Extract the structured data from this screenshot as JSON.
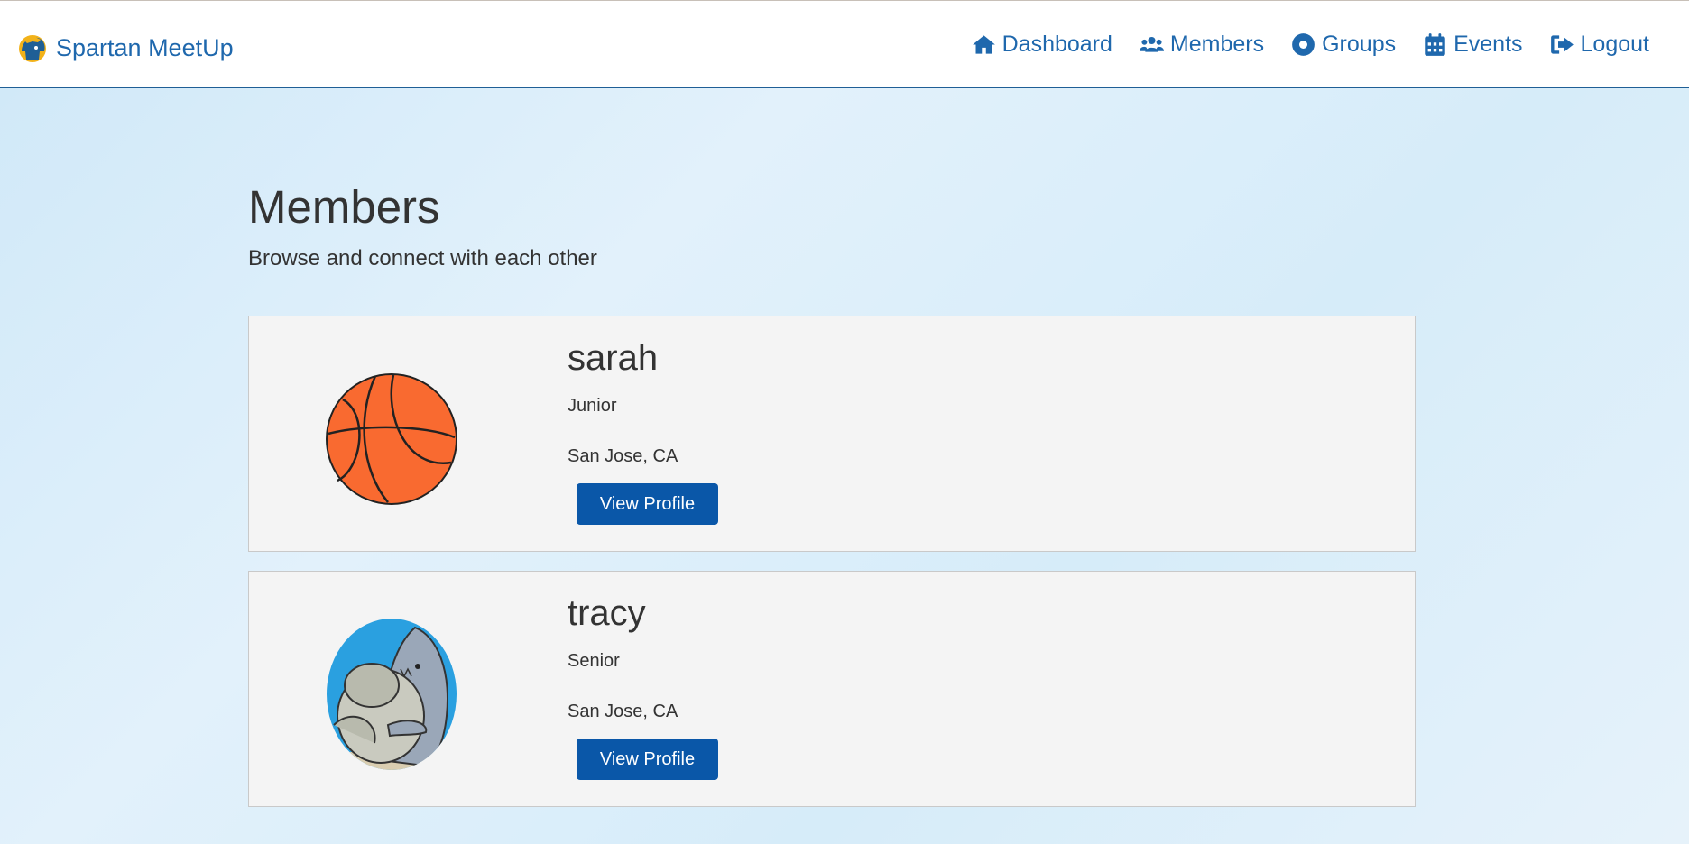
{
  "navbar": {
    "brand": "Spartan MeetUp",
    "items": [
      {
        "label": "Dashboard",
        "icon": "home-icon"
      },
      {
        "label": "Members",
        "icon": "users-icon"
      },
      {
        "label": "Groups",
        "icon": "circle-dot-icon"
      },
      {
        "label": "Events",
        "icon": "calendar-icon"
      },
      {
        "label": "Logout",
        "icon": "sign-out-icon"
      }
    ]
  },
  "page": {
    "title": "Members",
    "subtitle": "Browse and connect with each other"
  },
  "members": [
    {
      "name": "sarah",
      "year": "Junior",
      "location": "San Jose, CA",
      "button": "View Profile",
      "avatar": "basketball-avatar"
    },
    {
      "name": "tracy",
      "year": "Senior",
      "location": "San Jose, CA",
      "button": "View Profile",
      "avatar": "shark-manatee-avatar"
    }
  ],
  "colors": {
    "brand": "#1f68ad",
    "button": "#0a57a8",
    "card_bg": "#f4f4f4"
  }
}
